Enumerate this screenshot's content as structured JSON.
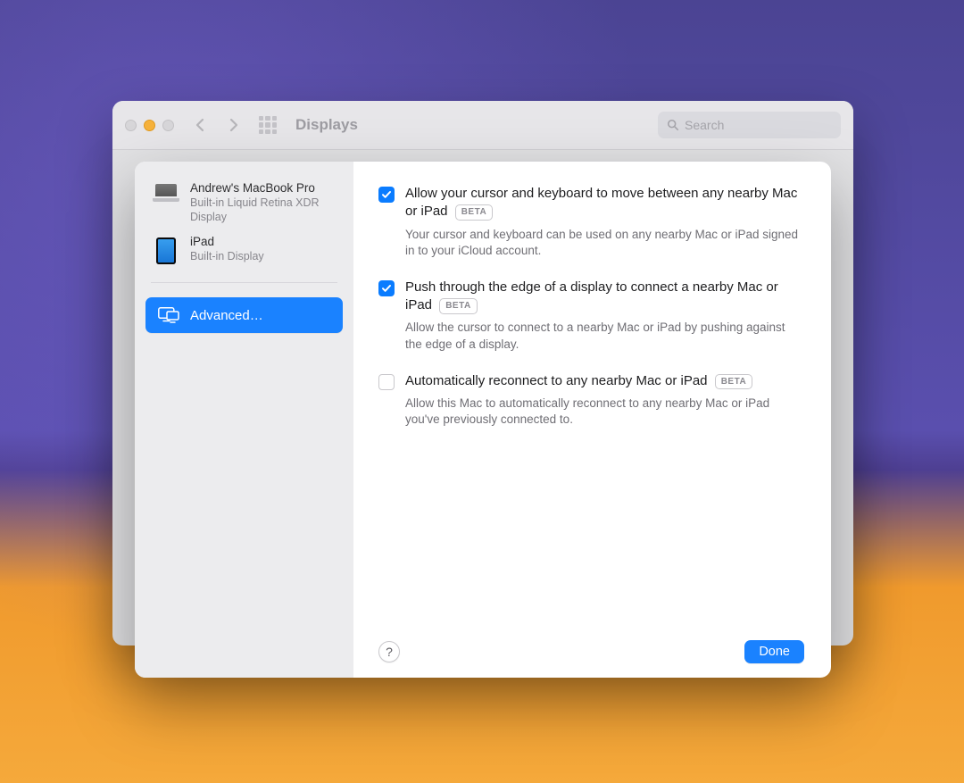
{
  "window": {
    "title": "Displays",
    "search_placeholder": "Search"
  },
  "sidebar": {
    "items": [
      {
        "title": "Andrew's MacBook Pro",
        "subtitle": "Built-in Liquid Retina XDR Display"
      },
      {
        "title": "iPad",
        "subtitle": "Built-in Display"
      }
    ],
    "advanced_label": "Advanced…"
  },
  "options": [
    {
      "checked": true,
      "label": "Allow your cursor and keyboard to move between any nearby Mac or iPad",
      "badge": "BETA",
      "description": "Your cursor and keyboard can be used on any nearby Mac or iPad signed in to your iCloud account."
    },
    {
      "checked": true,
      "label": "Push through the edge of a display to connect a nearby Mac or iPad",
      "badge": "BETA",
      "description": "Allow the cursor to connect to a nearby Mac or iPad by pushing against the edge of a display."
    },
    {
      "checked": false,
      "label": "Automatically reconnect to any nearby Mac or iPad",
      "badge": "BETA",
      "description": "Allow this Mac to automatically reconnect to any nearby Mac or iPad you've previously connected to."
    }
  ],
  "footer": {
    "help": "?",
    "done": "Done"
  }
}
